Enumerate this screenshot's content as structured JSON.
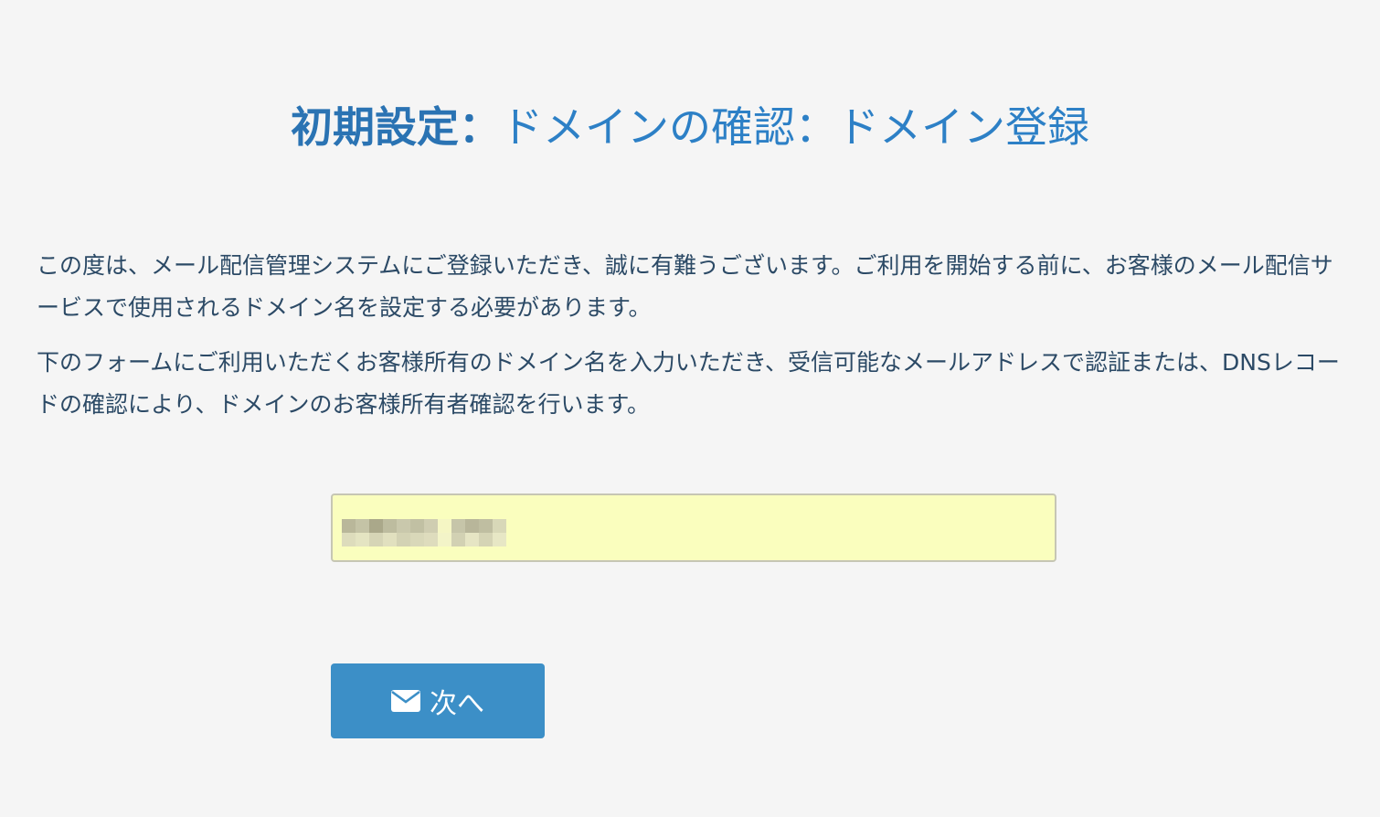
{
  "header": {
    "title_strong": "初期設定：",
    "title_rest": "ドメインの確認：ドメイン登録"
  },
  "intro": {
    "paragraph_1": "この度は、メール配信管理システムにご登録いただき、誠に有難うございます。ご利用を開始する前に、お客様のメール配信サービスで使用されるドメイン名を設定する必要があります。",
    "paragraph_2": "下のフォームにご利用いただくお客様所有のドメイン名を入力いただき、受信可能なメールアドレスで認証または、DNSレコードの確認により、ドメインのお客様所有者確認を行います。"
  },
  "form": {
    "domain_value": "",
    "domain_placeholder": "",
    "next_label": "次へ",
    "next_icon": "envelope-icon"
  },
  "colors": {
    "title": "#2d80c6",
    "text": "#2c4a66",
    "input_bg": "#fafebe",
    "button_bg": "#3c8fc7",
    "page_bg": "#f5f5f5"
  }
}
